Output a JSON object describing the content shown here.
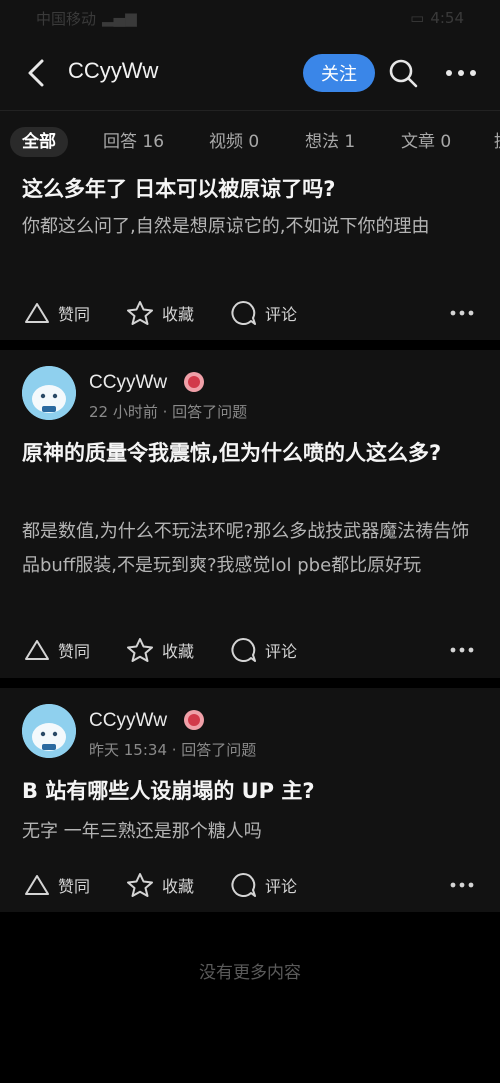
{
  "status_bar": {
    "carrier": "中国移动",
    "time": "4:54"
  },
  "header": {
    "title": "CCyyWw",
    "follow_label": "关注"
  },
  "tabs": [
    {
      "label": "全部"
    },
    {
      "label": "回答 16"
    },
    {
      "label": "视频 0"
    },
    {
      "label": "想法 1"
    },
    {
      "label": "文章 0"
    },
    {
      "label": "提"
    }
  ],
  "actions": {
    "agree": "赞同",
    "collect": "收藏",
    "comment": "评论"
  },
  "cards": [
    {
      "title": "这么多年了 日本可以被原谅了吗?",
      "body": "你都这么问了,自然是想原谅它的,不如说下你的理由"
    },
    {
      "author": "CCyyWw",
      "meta": "22 小时前 · 回答了问题",
      "title": "原神的质量令我震惊,但为什么喷的人这么多?",
      "body": "都是数值,为什么不玩法环呢?那么多战技武器魔法祷告饰品buff服装,不是玩到爽?我感觉lol pbe都比原好玩"
    },
    {
      "author": "CCyyWw",
      "meta": "昨天 15:34 · 回答了问题",
      "title": "B 站有哪些人设崩塌的 UP 主?",
      "body": "无字 一年三熟还是那个糖人吗"
    }
  ],
  "footer": {
    "no_more": "没有更多内容"
  },
  "colors": {
    "accent": "#3a86e8",
    "card_bg": "#121212",
    "page_bg": "#000000"
  }
}
